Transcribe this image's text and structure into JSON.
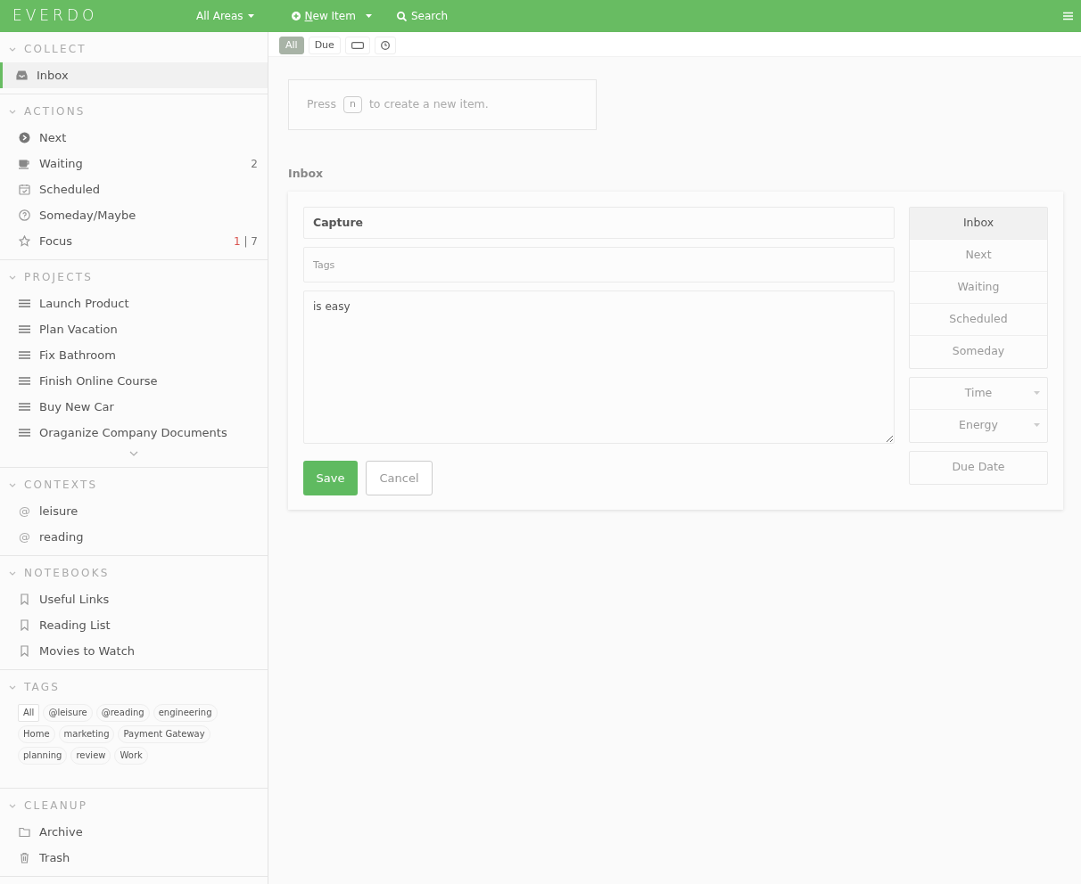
{
  "navbar": {
    "logo": "EVERDO",
    "area_menu": "All Areas",
    "new_item": "New Item",
    "search": "Search"
  },
  "sidebar": {
    "sections": [
      {
        "title": "COLLECT",
        "expanded": true,
        "items": [
          {
            "kind": "inbox",
            "label": "Inbox",
            "selected": true
          }
        ]
      },
      {
        "title": "ACTIONS",
        "expanded": true,
        "items": [
          {
            "kind": "next",
            "label": "Next",
            "selected": false
          },
          {
            "kind": "waiting",
            "label": "Waiting",
            "count": "2",
            "selected": false
          },
          {
            "kind": "scheduled",
            "label": "Scheduled",
            "selected": false
          },
          {
            "kind": "someday",
            "label": "Someday/Maybe",
            "selected": false
          },
          {
            "kind": "focus",
            "label": "Focus",
            "count_due": "1",
            "separator": "|",
            "count": "7",
            "selected": false
          }
        ]
      },
      {
        "title": "PROJECTS",
        "expanded": true,
        "more": true,
        "items": [
          {
            "kind": "project",
            "label": "Launch Product",
            "selected": false
          },
          {
            "kind": "project",
            "label": "Plan Vacation",
            "selected": false
          },
          {
            "kind": "project",
            "label": "Fix Bathroom",
            "selected": false
          },
          {
            "kind": "project",
            "label": "Finish Online Course",
            "selected": false
          },
          {
            "kind": "project",
            "label": "Buy New Car",
            "selected": false
          },
          {
            "kind": "project",
            "label": "Oraganize Company Documents",
            "selected": false
          }
        ]
      },
      {
        "title": "CONTEXTS",
        "expanded": true,
        "items": [
          {
            "kind": "context",
            "symbol": "@",
            "label": "leisure",
            "selected": false
          },
          {
            "kind": "context",
            "symbol": "@",
            "label": "reading",
            "selected": false
          }
        ]
      },
      {
        "title": "NOTEBOOKS",
        "expanded": true,
        "items": [
          {
            "kind": "notebook",
            "label": "Useful Links",
            "selected": false
          },
          {
            "kind": "notebook",
            "label": "Reading List",
            "selected": false
          },
          {
            "kind": "notebook",
            "label": "Movies to Watch",
            "selected": false
          }
        ]
      },
      {
        "title": "TAGS",
        "expanded": true,
        "tags": [
          {
            "label": "All",
            "selected": true
          },
          {
            "label": "@leisure",
            "selected": false
          },
          {
            "label": "@reading",
            "selected": false
          },
          {
            "label": "engineering",
            "selected": false
          },
          {
            "label": "Home",
            "selected": false
          },
          {
            "label": "marketing",
            "selected": false
          },
          {
            "label": "Payment Gateway",
            "selected": false
          },
          {
            "label": "planning",
            "selected": false
          },
          {
            "label": "review",
            "selected": false
          },
          {
            "label": "Work",
            "selected": false
          }
        ]
      },
      {
        "title": "CLEANUP",
        "expanded": true,
        "items": [
          {
            "kind": "archive",
            "label": "Archive",
            "selected": false
          },
          {
            "kind": "trash",
            "label": "Trash",
            "selected": false
          }
        ]
      }
    ]
  },
  "filters": [
    {
      "kind": "text",
      "label": "All",
      "selected": true
    },
    {
      "kind": "text",
      "label": "Due",
      "selected": false
    },
    {
      "kind": "card",
      "selected": false
    },
    {
      "kind": "clock",
      "selected": false
    }
  ],
  "hint": {
    "before": "Press",
    "key": "n",
    "after": "to create a new item."
  },
  "list_title": "Inbox",
  "editor": {
    "title_value": "Capture",
    "tags_placeholder": "Tags",
    "notes_value": "is easy",
    "save": "Save",
    "cancel": "Cancel",
    "lists": [
      {
        "label": "Inbox",
        "selected": true
      },
      {
        "label": "Next",
        "selected": false
      },
      {
        "label": "Waiting",
        "selected": false
      },
      {
        "label": "Scheduled",
        "selected": false
      },
      {
        "label": "Someday",
        "selected": false
      }
    ],
    "dropdowns": [
      "Time",
      "Energy"
    ],
    "due_date": "Due Date"
  }
}
